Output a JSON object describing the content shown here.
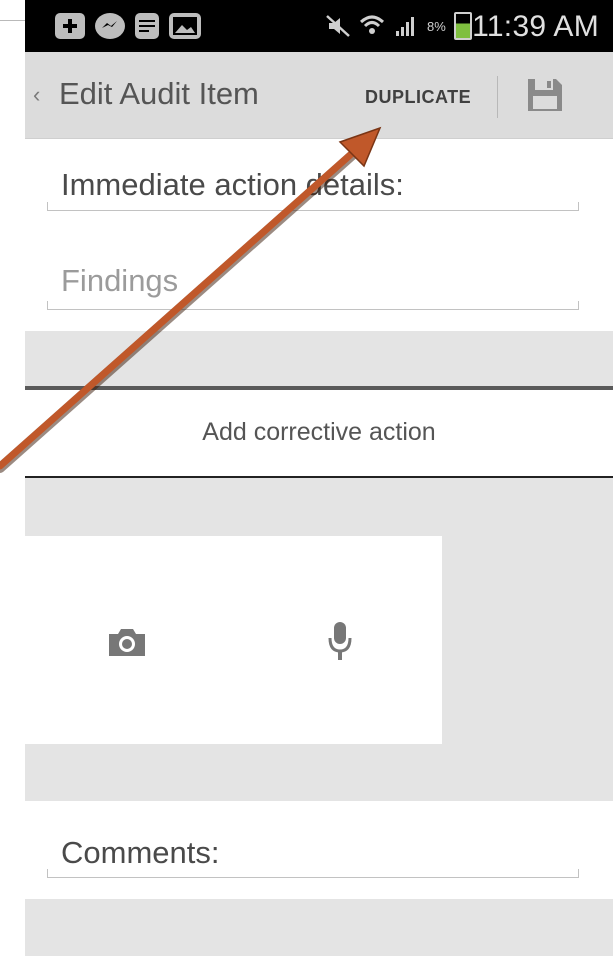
{
  "status_bar": {
    "battery_percent": "8%",
    "time": "11:39 AM"
  },
  "action_bar": {
    "back": "‹",
    "title": "Edit Audit Item",
    "duplicate_label": "DUPLICATE",
    "save_icon": "save-icon"
  },
  "form": {
    "immediate_action_label": "Immediate action details:",
    "findings_placeholder": "Findings",
    "add_corrective_action_label": "Add corrective action",
    "media": {
      "camera_icon": "camera-icon",
      "microphone_icon": "microphone-icon"
    },
    "comments_label": "Comments:"
  },
  "annotation": {
    "arrow_color": "#c0582a",
    "points_to": "duplicate-button"
  },
  "colors": {
    "status_bar_bg": "#000000",
    "action_bar_bg": "#dcdcdc",
    "screen_bg": "#e4e4e4"
  }
}
